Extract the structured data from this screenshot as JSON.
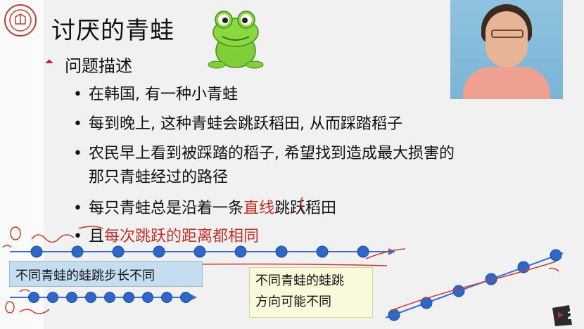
{
  "slide": {
    "title": "讨厌的青蛙",
    "section": "问题描述",
    "bullets": [
      {
        "pre": "在韩国, 有一种小青蛙",
        "red": "",
        "post": ""
      },
      {
        "pre": "每到晚上, 这种青蛙会跳跃稻田, 从而踩踏稻子",
        "red": "",
        "post": ""
      },
      {
        "pre": "农民早上看到被踩踏的稻子, 希望找到造成最大损害的",
        "red": "",
        "post": ""
      },
      {
        "pre": "那只青蛙经过的路径",
        "red": "",
        "post": ""
      },
      {
        "pre": "每只青蛙总是沿着一条",
        "red": "直线",
        "post": "跳跃稻田"
      },
      {
        "pre": "且",
        "red": "每次跳跃的距离都相同",
        "post": ""
      }
    ],
    "callout_1": "不同青蛙的蛙跳步长不同",
    "callout_2_line1": "不同青蛙的蛙跳",
    "callout_2_line2": "方向可能不同",
    "page_number": "2"
  },
  "colors": {
    "accent_red": "#c0302a",
    "dot_blue": "#2f67c6",
    "line_blue": "#3a6fd0",
    "callout_1_bg": "#c6ddf0",
    "callout_2_bg": "#fbf9dc"
  },
  "icons": [
    "university-seal-icon",
    "frog-icon",
    "video-feed",
    "page-badge-icon"
  ]
}
